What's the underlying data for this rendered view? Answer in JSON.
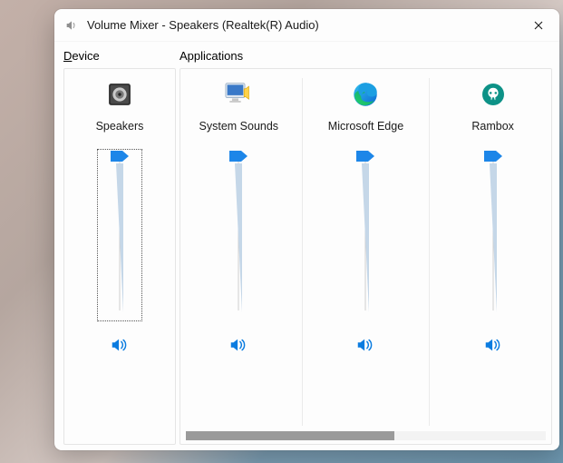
{
  "window": {
    "title": "Volume Mixer - Speakers (Realtek(R) Audio)"
  },
  "sections": {
    "device_label_underline": "D",
    "device_label_rest": "evice",
    "apps_label": "Applications"
  },
  "device": {
    "name": "Speakers",
    "volume": 100,
    "muted": false
  },
  "applications": [
    {
      "name": "System Sounds",
      "icon": "monitor",
      "volume": 100,
      "muted": false
    },
    {
      "name": "Microsoft Edge",
      "icon": "edge",
      "volume": 100,
      "muted": false
    },
    {
      "name": "Rambox",
      "icon": "rambox",
      "volume": 100,
      "muted": false
    }
  ],
  "colors": {
    "accent": "#0b7ce0",
    "thumb": "#1d86e8"
  }
}
